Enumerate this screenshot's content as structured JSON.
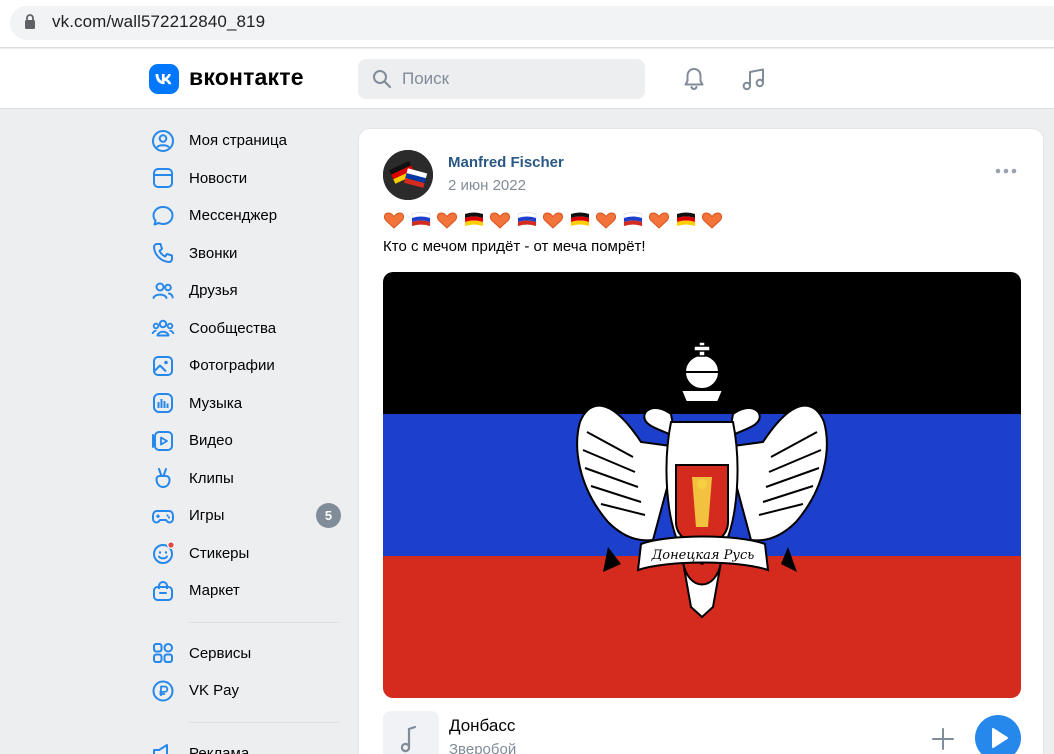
{
  "browser": {
    "url": "vk.com/wall572212840_819"
  },
  "header": {
    "logo_text": "вконтакте",
    "search_placeholder": "Поиск",
    "accent": "#0077ff"
  },
  "sidebar": {
    "items": [
      {
        "label": "Моя страница",
        "icon": "user-circle-icon"
      },
      {
        "label": "Новости",
        "icon": "news-icon"
      },
      {
        "label": "Мессенджер",
        "icon": "message-icon"
      },
      {
        "label": "Звонки",
        "icon": "phone-icon"
      },
      {
        "label": "Друзья",
        "icon": "friends-icon"
      },
      {
        "label": "Сообщества",
        "icon": "communities-icon"
      },
      {
        "label": "Фотографии",
        "icon": "photo-icon"
      },
      {
        "label": "Музыка",
        "icon": "music-icon"
      },
      {
        "label": "Видео",
        "icon": "video-icon"
      },
      {
        "label": "Клипы",
        "icon": "clips-icon"
      },
      {
        "label": "Игры",
        "icon": "games-icon",
        "badge": "5"
      },
      {
        "label": "Стикеры",
        "icon": "stickers-icon"
      },
      {
        "label": "Маркет",
        "icon": "market-icon"
      }
    ],
    "services": [
      {
        "label": "Сервисы",
        "icon": "services-icon"
      },
      {
        "label": "VK Pay",
        "icon": "vkpay-icon"
      }
    ],
    "extra": [
      {
        "label": "Реклама",
        "icon": "ads-icon"
      }
    ]
  },
  "post": {
    "author": "Manfred Fischer",
    "date": "2 июн 2022",
    "emoji_sequence": [
      "heart",
      "ru",
      "heart",
      "de",
      "heart",
      "ru",
      "heart",
      "de",
      "heart",
      "ru",
      "heart",
      "de",
      "heart"
    ],
    "text": "Кто с мечом придёт - от меча помрёт!",
    "image": {
      "stripes": [
        "#000000",
        "#1c3fcc",
        "#d52b1e"
      ],
      "emblem_ribbon_text": "Донецкая Русь"
    },
    "audio": {
      "title": "Донбасс",
      "artist": "Зверобой"
    }
  }
}
